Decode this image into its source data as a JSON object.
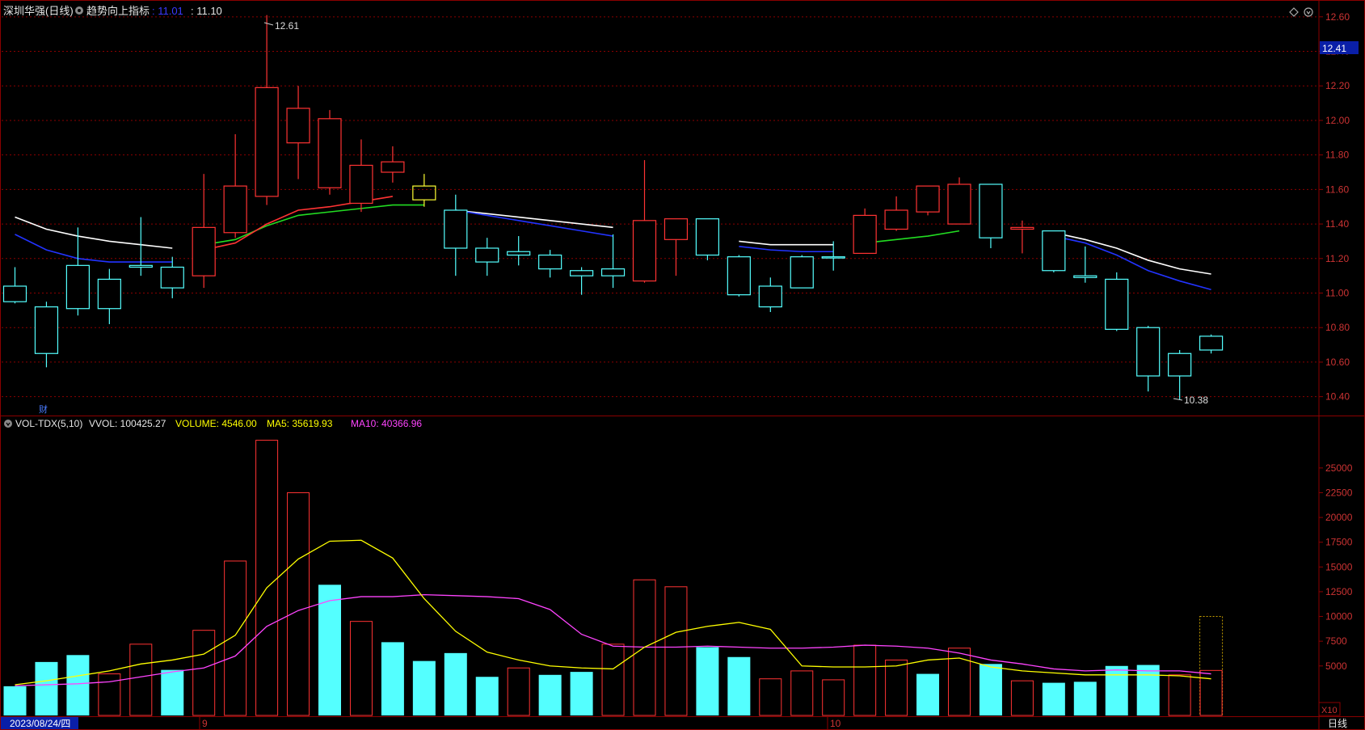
{
  "header": {
    "stock_name": "深圳华强(日线)",
    "indicator_name": "趋势向上指标",
    "value1": ": 11.01",
    "value2": ": 11.10",
    "icons": [
      "diamond-icon",
      "settings-icon"
    ]
  },
  "price_axis": {
    "ticks": [
      "12.60",
      "12.40",
      "12.20",
      "12.00",
      "11.80",
      "11.60",
      "11.40",
      "11.20",
      "11.00",
      "10.80",
      "10.60",
      "10.40"
    ],
    "current_price_tag": "12.41"
  },
  "volume_header": {
    "indicator": "VOL-TDX(5,10)",
    "vvol": "VVOL: 100425.27",
    "volume": "VOLUME: 4546.00",
    "ma5": "MA5: 35619.93",
    "ma10": "MA10: 40366.96"
  },
  "volume_axis": {
    "ticks": [
      "25000",
      "22500",
      "20000",
      "17500",
      "15000",
      "12500",
      "10000",
      "7500",
      "5000"
    ],
    "unit": "X10"
  },
  "bottom_bar": {
    "date_label": "2023/08/24/四",
    "month_markers": [
      "9",
      "10"
    ],
    "period_tab": "日线"
  },
  "annotations": {
    "high_label": "12.61",
    "low_label": "10.38",
    "finance_marker": "财"
  },
  "colors": {
    "up": "#ff3333",
    "down": "#54ffff",
    "doji": "#ffff33",
    "ma_white": "#ffffff",
    "ma_blue": "#2233ff",
    "ma_green": "#22dd22",
    "vol_ma5": "#ffff00",
    "vol_ma10": "#ff44ff",
    "grid": "#8b0000"
  },
  "chart_data": {
    "type": "candlestick",
    "price_range": [
      10.3,
      12.66
    ],
    "volume_range": [
      0,
      28500
    ],
    "candles": [
      {
        "o": 11.04,
        "h": 11.15,
        "l": 10.94,
        "c": 10.95
      },
      {
        "o": 10.92,
        "h": 10.95,
        "l": 10.57,
        "c": 10.65
      },
      {
        "o": 11.16,
        "h": 11.38,
        "l": 10.87,
        "c": 10.91
      },
      {
        "o": 11.08,
        "h": 11.14,
        "l": 10.82,
        "c": 10.91
      },
      {
        "o": 11.16,
        "h": 11.44,
        "l": 11.1,
        "c": 11.15
      },
      {
        "o": 11.15,
        "h": 11.21,
        "l": 10.97,
        "c": 11.03
      },
      {
        "o": 11.1,
        "h": 11.69,
        "l": 11.03,
        "c": 11.38
      },
      {
        "o": 11.35,
        "h": 11.92,
        "l": 11.32,
        "c": 11.62
      },
      {
        "o": 11.56,
        "h": 12.61,
        "l": 11.51,
        "c": 12.19
      },
      {
        "o": 11.87,
        "h": 12.2,
        "l": 11.66,
        "c": 12.07
      },
      {
        "o": 11.61,
        "h": 12.06,
        "l": 11.57,
        "c": 12.01
      },
      {
        "o": 11.52,
        "h": 11.89,
        "l": 11.47,
        "c": 11.74
      },
      {
        "o": 11.7,
        "h": 11.85,
        "l": 11.64,
        "c": 11.76
      },
      {
        "o": 11.54,
        "h": 11.69,
        "l": 11.5,
        "c": 11.62
      },
      {
        "o": 11.48,
        "h": 11.57,
        "l": 11.1,
        "c": 11.26
      },
      {
        "o": 11.26,
        "h": 11.32,
        "l": 11.1,
        "c": 11.18
      },
      {
        "o": 11.24,
        "h": 11.33,
        "l": 11.16,
        "c": 11.22
      },
      {
        "o": 11.22,
        "h": 11.25,
        "l": 11.09,
        "c": 11.14
      },
      {
        "o": 11.13,
        "h": 11.15,
        "l": 10.99,
        "c": 11.1
      },
      {
        "o": 11.14,
        "h": 11.34,
        "l": 11.03,
        "c": 11.1
      },
      {
        "o": 11.07,
        "h": 11.77,
        "l": 11.06,
        "c": 11.42
      },
      {
        "o": 11.31,
        "h": 11.43,
        "l": 11.1,
        "c": 11.43
      },
      {
        "o": 11.43,
        "h": 11.43,
        "l": 11.19,
        "c": 11.22
      },
      {
        "o": 11.21,
        "h": 11.22,
        "l": 10.98,
        "c": 10.99
      },
      {
        "o": 11.04,
        "h": 11.09,
        "l": 10.89,
        "c": 10.92
      },
      {
        "o": 11.21,
        "h": 11.22,
        "l": 11.03,
        "c": 11.03
      },
      {
        "o": 11.21,
        "h": 11.3,
        "l": 11.13,
        "c": 11.21
      },
      {
        "o": 11.23,
        "h": 11.49,
        "l": 11.23,
        "c": 11.45
      },
      {
        "o": 11.37,
        "h": 11.56,
        "l": 11.36,
        "c": 11.48
      },
      {
        "o": 11.47,
        "h": 11.59,
        "l": 11.45,
        "c": 11.62
      },
      {
        "o": 11.4,
        "h": 11.67,
        "l": 11.4,
        "c": 11.63
      },
      {
        "o": 11.63,
        "h": 11.63,
        "l": 11.26,
        "c": 11.32
      },
      {
        "o": 11.37,
        "h": 11.42,
        "l": 11.23,
        "c": 11.38
      },
      {
        "o": 11.36,
        "h": 11.36,
        "l": 11.12,
        "c": 11.13
      },
      {
        "o": 11.1,
        "h": 11.27,
        "l": 11.06,
        "c": 11.09
      },
      {
        "o": 11.08,
        "h": 11.12,
        "l": 10.78,
        "c": 10.79
      },
      {
        "o": 10.8,
        "h": 10.81,
        "l": 10.43,
        "c": 10.52
      },
      {
        "o": 10.65,
        "h": 10.67,
        "l": 10.38,
        "c": 10.52
      },
      {
        "o": 10.67,
        "h": 10.76,
        "l": 10.65,
        "c": 10.75
      }
    ],
    "candle_kind": [
      "down",
      "down",
      "down",
      "down",
      "down",
      "down",
      "up",
      "up",
      "up",
      "up",
      "up",
      "up",
      "up",
      "doji",
      "down",
      "down",
      "down",
      "down",
      "down",
      "down",
      "up",
      "up",
      "down",
      "down",
      "down",
      "down",
      "down",
      "up",
      "up",
      "up",
      "up",
      "down",
      "up",
      "down",
      "down",
      "down",
      "down",
      "down",
      "down"
    ],
    "volumes": [
      2950,
      5400,
      6100,
      4200,
      7200,
      4600,
      8600,
      15600,
      27800,
      22500,
      13200,
      9500,
      7400,
      5500,
      6300,
      3900,
      4800,
      4100,
      4400,
      7200,
      13700,
      13000,
      6900,
      5900,
      3700,
      4500,
      3600,
      7100,
      5600,
      4200,
      6800,
      5200,
      3500,
      3300,
      3400,
      5000,
      5100,
      4100,
      4546
    ],
    "volume_kind": [
      "down",
      "down",
      "down",
      "up",
      "up",
      "down",
      "up",
      "up",
      "up",
      "up",
      "down",
      "up",
      "down",
      "down",
      "down",
      "down",
      "up",
      "down",
      "down",
      "up",
      "up",
      "up",
      "down",
      "down",
      "up",
      "up",
      "up",
      "up",
      "up",
      "down",
      "up",
      "down",
      "up",
      "down",
      "down",
      "down",
      "down",
      "up",
      "up"
    ],
    "ma_white": {
      "x": [
        0,
        1,
        2,
        3,
        4,
        5,
        14,
        15,
        16,
        17,
        18,
        19,
        23,
        24,
        25,
        26,
        33,
        34,
        35,
        36,
        37,
        38
      ],
      "y": [
        11.44,
        11.37,
        11.33,
        11.3,
        11.28,
        11.26,
        11.48,
        11.46,
        11.44,
        11.42,
        11.4,
        11.38,
        11.3,
        11.28,
        11.28,
        11.28,
        11.35,
        11.31,
        11.26,
        11.19,
        11.14,
        11.11
      ]
    },
    "ma_blue": {
      "x": [
        0,
        1,
        2,
        3,
        4,
        5,
        14,
        15,
        16,
        17,
        18,
        19,
        23,
        24,
        25,
        26,
        33,
        34,
        35,
        36,
        37,
        38
      ],
      "y": [
        11.34,
        11.25,
        11.2,
        11.18,
        11.18,
        11.18,
        11.48,
        11.45,
        11.42,
        11.39,
        11.36,
        11.33,
        11.27,
        11.25,
        11.24,
        11.24,
        11.33,
        11.29,
        11.22,
        11.13,
        11.07,
        11.02
      ]
    },
    "ma_red": {
      "x": [
        6,
        7,
        8,
        9,
        10,
        11,
        12
      ],
      "y": [
        11.25,
        11.29,
        11.4,
        11.48,
        11.5,
        11.53,
        11.56
      ]
    },
    "ma_green": {
      "x": [
        6,
        7,
        8,
        9,
        10,
        11,
        12,
        13
      ],
      "y": [
        11.28,
        11.31,
        11.39,
        11.45,
        11.47,
        11.49,
        11.51,
        11.51
      ]
    },
    "ma_green2": {
      "x": [
        27,
        28,
        29,
        30
      ],
      "y": [
        11.29,
        11.31,
        11.33,
        11.36
      ]
    },
    "vol_ma5": [
      3100,
      3500,
      4000,
      4500,
      5200,
      5600,
      6200,
      8100,
      12900,
      15800,
      17600,
      17700,
      15900,
      11800,
      8500,
      6400,
      5600,
      5000,
      4800,
      4700,
      6900,
      8400,
      9000,
      9400,
      8700,
      5000,
      4900,
      4900,
      5000,
      5600,
      5800,
      4900,
      4500,
      4300,
      4100,
      4100,
      4100,
      4000,
      3700
    ],
    "vol_ma10": [
      3000,
      3100,
      3200,
      3400,
      3900,
      4400,
      4800,
      6000,
      9000,
      10600,
      11600,
      12000,
      12000,
      12200,
      12100,
      12000,
      11800,
      10700,
      8200,
      7000,
      6900,
      6900,
      7000,
      6900,
      6800,
      6800,
      6900,
      7100,
      7000,
      6800,
      6300,
      5600,
      5200,
      4700,
      4500,
      4600,
      4500,
      4500,
      4200
    ]
  }
}
